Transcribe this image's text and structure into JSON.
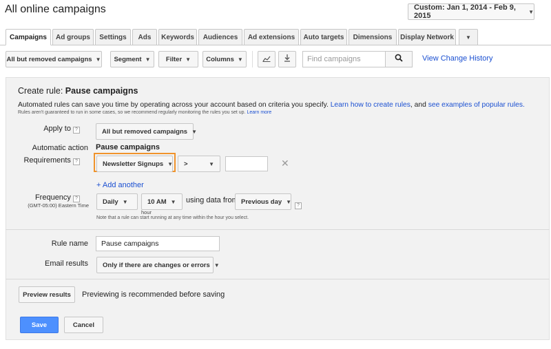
{
  "header": {
    "title": "All online campaigns",
    "date_range": "Custom: Jan 1, 2014 - Feb 9, 2015"
  },
  "tabs": [
    {
      "label": "Campaigns",
      "active": true
    },
    {
      "label": "Ad groups"
    },
    {
      "label": "Settings"
    },
    {
      "label": "Ads"
    },
    {
      "label": "Keywords"
    },
    {
      "label": "Audiences"
    },
    {
      "label": "Ad extensions"
    },
    {
      "label": "Auto targets"
    },
    {
      "label": "Dimensions"
    },
    {
      "label": "Display Network"
    }
  ],
  "toolbar": {
    "campaign_filter": "All but removed campaigns",
    "segment": "Segment",
    "filter": "Filter",
    "columns": "Columns",
    "search_placeholder": "Find campaigns",
    "view_history": "View Change History"
  },
  "rule": {
    "heading_prefix": "Create rule:",
    "heading_name": "Pause campaigns",
    "intro": "Automated rules can save you time by operating across your account based on criteria you specify.",
    "link_create": "Learn how to create rules",
    "intro_and": ", and",
    "link_examples": "see examples of popular rules.",
    "disclaimer": "Rules aren't guaranteed to run in some cases, so we recommend regularly monitoring the rules you set up.",
    "learn_more": "Learn more",
    "apply_to_label": "Apply to",
    "apply_to_value": "All but removed campaigns",
    "automatic_action_label": "Automatic action",
    "automatic_action_value": "Pause campaigns",
    "requirements_label": "Requirements",
    "requirement_metric": "Newsletter Signups",
    "requirement_operator": ">",
    "requirement_value": "",
    "add_another": "+ Add another",
    "frequency_label": "Frequency",
    "timezone": "(GMT-05:00) Eastern Time",
    "frequency_value": "Daily",
    "hour_value": "10 AM",
    "hour_caption": "hour",
    "using_data_from": "using data from",
    "data_range": "Previous day",
    "frequency_note": "Note that a rule can start running at any time within the hour you select.",
    "rule_name_label": "Rule name",
    "rule_name_value": "Pause campaigns",
    "email_label": "Email results",
    "email_value": "Only if there are changes or errors",
    "preview_button": "Preview results",
    "preview_note": "Previewing is recommended before saving",
    "save_button": "Save",
    "cancel_button": "Cancel"
  },
  "colors": {
    "accent_blue": "#4d90fe",
    "link_blue": "#1a4fd1",
    "highlight_orange": "#f0932b"
  }
}
